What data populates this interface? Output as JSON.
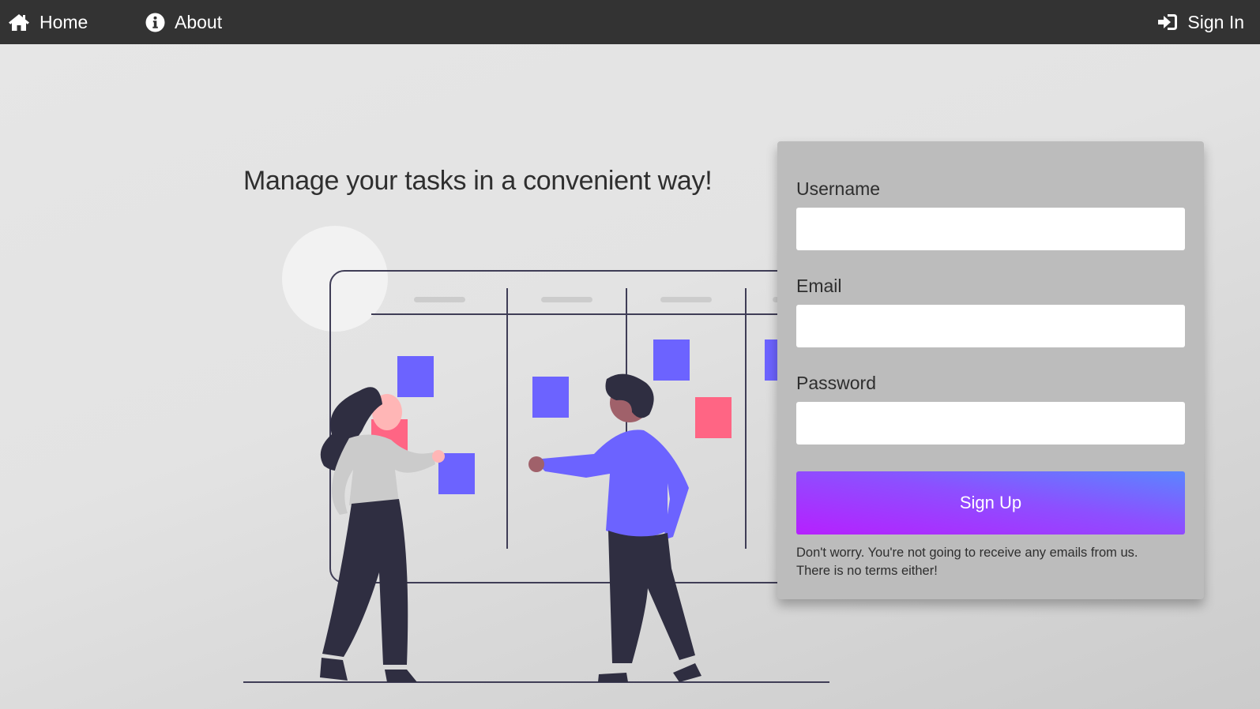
{
  "nav": {
    "home_label": "Home",
    "about_label": "About",
    "signin_label": "Sign In",
    "icons": [
      "home-icon",
      "info-icon",
      "sign-in-icon"
    ]
  },
  "hero": {
    "title": "Manage your tasks in a convenient way!"
  },
  "form": {
    "username_label": "Username",
    "username_value": "",
    "email_label": "Email",
    "email_value": "",
    "password_label": "Password",
    "password_value": "",
    "submit_label": "Sign Up",
    "disclaimer_line1": "Don't worry. You're not going to receive any emails from us.",
    "disclaimer_line2": "There is no terms either!"
  },
  "colors": {
    "navbar": "#333333",
    "card": "#bcbcbc",
    "button_gradient_start": "#b620ff",
    "button_gradient_end": "#5a86ff",
    "sticky_purple": "#6c63ff",
    "sticky_pink": "#ff6584",
    "ink": "#2f2e41"
  }
}
